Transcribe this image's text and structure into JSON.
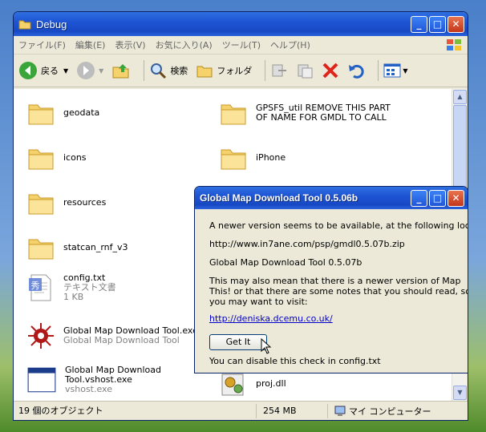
{
  "window": {
    "title": "Debug"
  },
  "menu": [
    "ファイル(F)",
    "編集(E)",
    "表示(V)",
    "お気に入り(A)",
    "ツール(T)",
    "ヘルプ(H)"
  ],
  "toolbar": {
    "back": "戻る",
    "search": "検索",
    "folders": "フォルダ"
  },
  "files": [
    {
      "name": "geodata",
      "icon": "folder-icon"
    },
    {
      "name": "GPSFS_util REMOVE THIS PART OF NAME FOR GMDL TO CALL",
      "icon": "folder-icon"
    },
    {
      "name": "icons",
      "icon": "folder-icon"
    },
    {
      "name": "iPhone",
      "icon": "folder-icon"
    },
    {
      "name": "resources",
      "icon": "folder-icon"
    },
    {
      "name": "statcan_rnf_v3",
      "icon": "folder-icon"
    },
    {
      "name": "config.txt",
      "type": "テキスト文書",
      "size": "1 KB",
      "icon": "text-file-icon"
    },
    {
      "name": "Global Map Download Tool.exe",
      "type": "Global Map Download Tool",
      "icon": "app-exe-icon"
    },
    {
      "name": "Global Map Download Tool.vshost.exe",
      "type": "vshost.exe",
      "icon": "exe-window-icon"
    },
    {
      "name": "proj.dll",
      "icon": "dll-gear-icon"
    }
  ],
  "status": {
    "count": "19 個のオブジェクト",
    "size": "254 MB",
    "location": "マイ コンピューター"
  },
  "dialog": {
    "title": "Global Map Download Tool 0.5.06b",
    "line1": "A newer version seems to be available, at the following location",
    "url": "http://www.in7ane.com/psp/gmdl0.5.07b.zip",
    "version": "Global Map Download Tool 0.5.07b",
    "msg1": "This may also mean that there is a newer version of Map",
    "msg2": "This! or that there are some notes that you should read, so",
    "msg3": "you may want to visit:",
    "link": "http://deniska.dcemu.co.uk/",
    "button": "Get It",
    "footer": "You can disable this check in config.txt"
  },
  "colors": {
    "titlebar": "#1e55d4",
    "close": "#c4361a",
    "folder": "#f5d26b"
  }
}
